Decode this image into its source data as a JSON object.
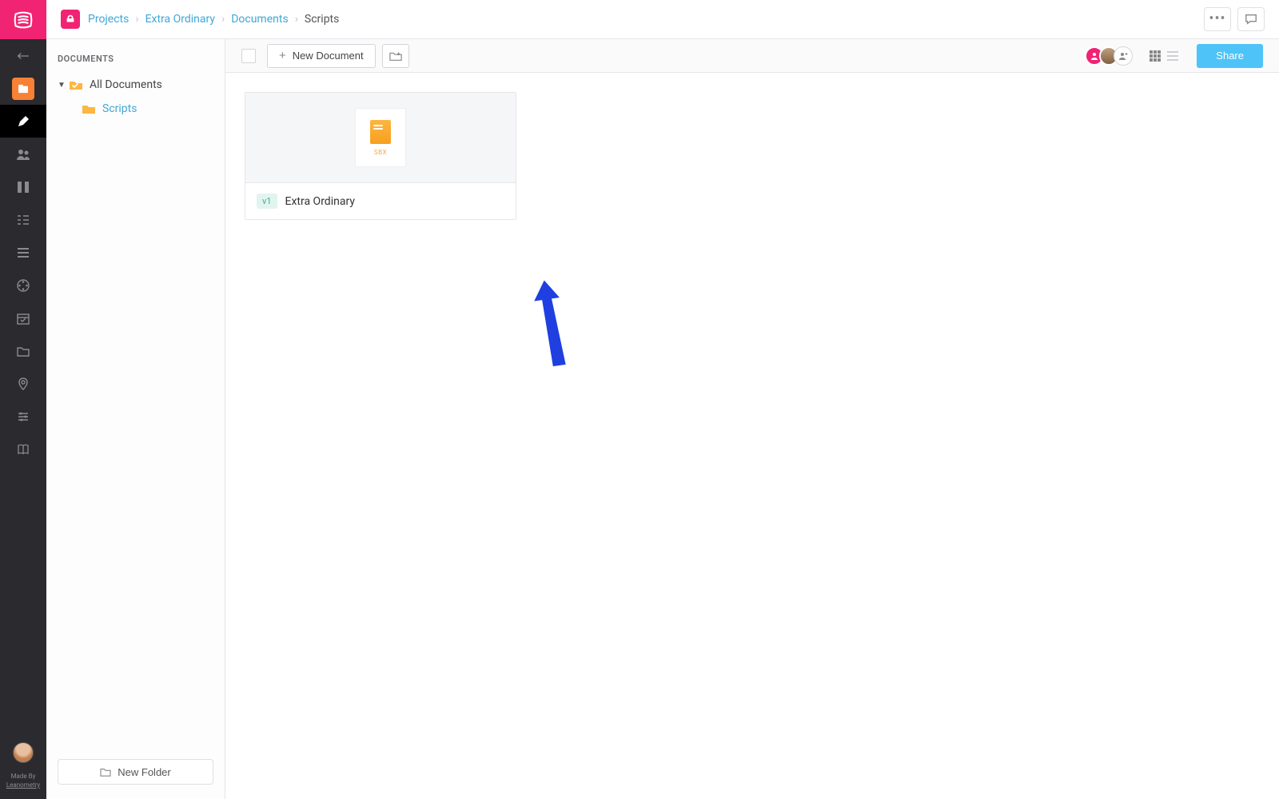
{
  "breadcrumb": {
    "projects": "Projects",
    "project_name": "Extra Ordinary",
    "documents": "Documents",
    "current": "Scripts"
  },
  "doc_panel": {
    "heading": "DOCUMENTS",
    "root": "All Documents",
    "child": "Scripts",
    "new_folder": "New Folder"
  },
  "toolbar": {
    "new_document": "New Document",
    "share": "Share"
  },
  "card": {
    "thumb_tag": "SBX",
    "version": "v1",
    "title": "Extra Ordinary"
  },
  "footer": {
    "made_by": "Made By",
    "credit": "Leanometry"
  },
  "icons": {
    "back": "back-arrow-icon",
    "documents": "documents-icon",
    "edit": "pencil-icon",
    "people": "people-icon",
    "boards": "boards-icon",
    "tasks": "tasks-icon",
    "list": "list-icon",
    "reel": "reel-icon",
    "calendar": "calendar-icon",
    "folder": "folder-icon",
    "location": "location-icon",
    "settings": "sliders-icon",
    "book": "book-icon"
  }
}
